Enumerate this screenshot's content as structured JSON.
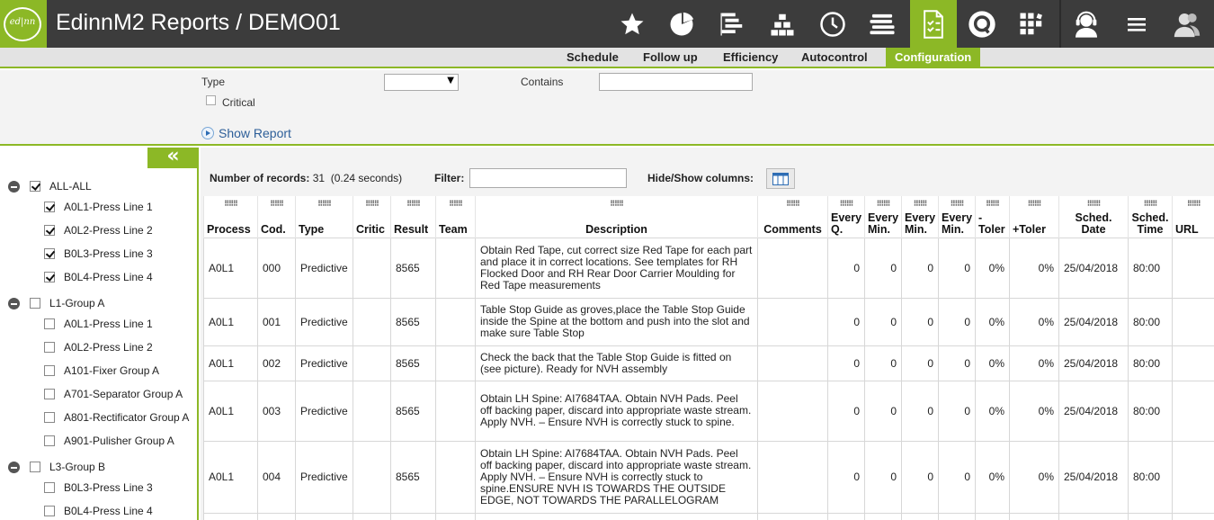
{
  "header": {
    "logo_text": "ed|nn",
    "title": "EdinnM2 Reports / DEMO01",
    "icons": [
      "star-icon",
      "pie-chart-icon",
      "bar-list-icon",
      "pyramid-icon",
      "clock-icon",
      "money-stack-icon",
      "checklist-doc-icon",
      "q-circle-icon",
      "grid-tiles-icon",
      "support-agent-icon",
      "hamburger-menu-icon",
      "user-icon"
    ],
    "accent_color": "#8cb826",
    "bar_color": "#3c3c3c"
  },
  "submenu": {
    "items": [
      "Schedule",
      "Follow up",
      "Efficiency",
      "Autocontrol",
      "Configuration"
    ],
    "active": "Configuration"
  },
  "filters": {
    "type_label": "Type",
    "type_value": "",
    "contains_label": "Contains",
    "contains_value": "",
    "critical_label": "Critical",
    "show_report": "Show Report"
  },
  "sidebar": {
    "collapse_glyph": "«",
    "tree": [
      {
        "label": "ALL-ALL",
        "group": true,
        "checked": true
      },
      {
        "label": "A0L1-Press Line 1",
        "group": false,
        "checked": true
      },
      {
        "label": "A0L2-Press Line 2",
        "group": false,
        "checked": true
      },
      {
        "label": "B0L3-Press Line 3",
        "group": false,
        "checked": true
      },
      {
        "label": "B0L4-Press Line 4",
        "group": false,
        "checked": true
      },
      {
        "label": "L1-Group A",
        "group": true,
        "checked": false
      },
      {
        "label": "A0L1-Press Line 1",
        "group": false,
        "checked": false
      },
      {
        "label": "A0L2-Press Line 2",
        "group": false,
        "checked": false
      },
      {
        "label": "A101-Fixer Group A",
        "group": false,
        "checked": false
      },
      {
        "label": "A701-Separator Group A",
        "group": false,
        "checked": false
      },
      {
        "label": "A801-Rectificator Group A",
        "group": false,
        "checked": false
      },
      {
        "label": "A901-Pulisher Group A",
        "group": false,
        "checked": false
      },
      {
        "label": "L3-Group B",
        "group": true,
        "checked": false
      },
      {
        "label": "B0L3-Press Line 3",
        "group": false,
        "checked": false
      },
      {
        "label": "B0L4-Press Line 4",
        "group": false,
        "checked": false
      }
    ]
  },
  "main": {
    "records_label": "Number of records:",
    "records_count": "31",
    "records_time": "(0.24 seconds)",
    "filter_label": "Filter:",
    "filter_value": "",
    "hide_show_label": "Hide/Show columns:"
  },
  "table": {
    "columns": [
      "Process",
      "Cod.",
      "Type",
      "Critic",
      "Result",
      "Team",
      "Description",
      "Comments",
      "Every Q.",
      "Every Min.",
      "Every Min.",
      "Every Min.",
      "- Toler",
      "+Toler",
      "Sched. Date",
      "Sched. Time",
      "URL"
    ],
    "rows": [
      [
        "A0L1",
        "000",
        "Predictive",
        "",
        "8565",
        "",
        "Obtain Red Tape, cut correct size Red Tape for each part and place it in correct locations. See templates for RH Flocked Door and RH Rear Door Carrier Moulding for Red Tape measurements",
        "",
        "0",
        "0",
        "0",
        "0",
        "0%",
        "0%",
        "25/04/2018",
        "80:00",
        ""
      ],
      [
        "A0L1",
        "001",
        "Predictive",
        "",
        "8565",
        "",
        "Table Stop Guide as groves,place the Table Stop Guide inside the Spine at the bottom and push into the slot and make sure Table Stop",
        "",
        "0",
        "0",
        "0",
        "0",
        "0%",
        "0%",
        "25/04/2018",
        "80:00",
        ""
      ],
      [
        "A0L1",
        "002",
        "Predictive",
        "",
        "8565",
        "",
        "Check the back that the Table Stop Guide is fitted on (see picture). Ready for NVH assembly",
        "",
        "0",
        "0",
        "0",
        "0",
        "0%",
        "0%",
        "25/04/2018",
        "80:00",
        ""
      ],
      [
        "A0L1",
        "003",
        "Predictive",
        "",
        "8565",
        "",
        "Obtain LH Spine: AI7684TAA. Obtain NVH Pads. Peel off backing paper, discard into appropriate waste stream. Apply NVH. – Ensure NVH is correctly stuck to spine.",
        "",
        "0",
        "0",
        "0",
        "0",
        "0%",
        "0%",
        "25/04/2018",
        "80:00",
        ""
      ],
      [
        "A0L1",
        "004",
        "Predictive",
        "",
        "8565",
        "",
        "Obtain LH Spine: AI7684TAA. Obtain NVH Pads. Peel off backing paper, discard into appropriate waste stream. Apply NVH. – Ensure NVH is correctly stuck to spine.ENSURE NVH IS TOWARDS THE OUTSIDE EDGE, NOT TOWARDS THE PARALLELOGRAM",
        "",
        "0",
        "0",
        "0",
        "0",
        "0%",
        "0%",
        "25/04/2018",
        "80:00",
        ""
      ],
      [
        "",
        "",
        "",
        "",
        "",
        "",
        "",
        "",
        "",
        "",
        "",
        "",
        "",
        "",
        "",
        "",
        ""
      ]
    ]
  }
}
